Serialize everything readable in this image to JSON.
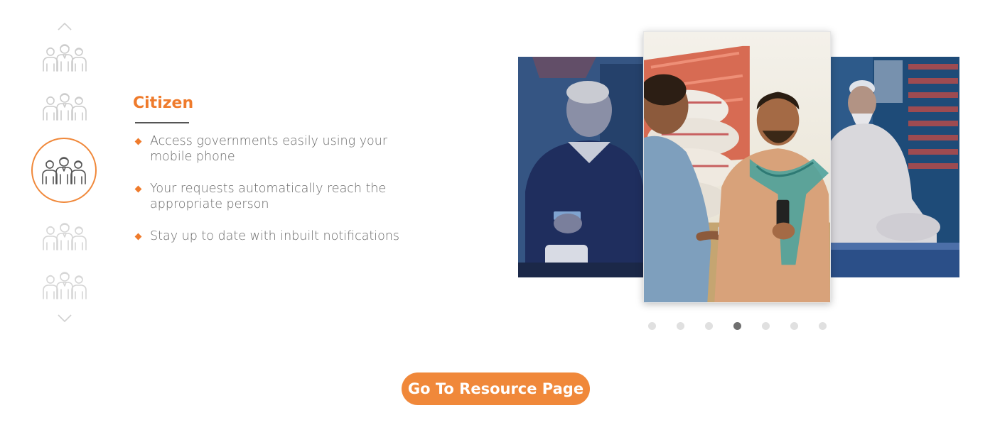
{
  "nav": {
    "up_icon": "chevron-up-icon",
    "down_icon": "chevron-down-icon",
    "persona_icon": "group-of-people-icon",
    "active_index": 2,
    "active_color": "#f0883a",
    "inactive_color": "#c8c8c8"
  },
  "persona": {
    "title": "Citizen",
    "features": [
      "Access governments easily using your mobile phone",
      "Your requests automatically reach the appropriate person",
      "Stay up to date with inbuilt notifications"
    ]
  },
  "carousel": {
    "slides": [
      {
        "position": "left",
        "description_icon": "photo-elderly-man-with-card"
      },
      {
        "position": "center",
        "description_icon": "photo-two-men-with-phones"
      },
      {
        "position": "right",
        "description_icon": "photo-shopkeeper-sitting"
      }
    ],
    "dot_count": 7,
    "active_dot": 4
  },
  "cta": {
    "label": "Go To Resource Page",
    "color": "#f0883a"
  }
}
